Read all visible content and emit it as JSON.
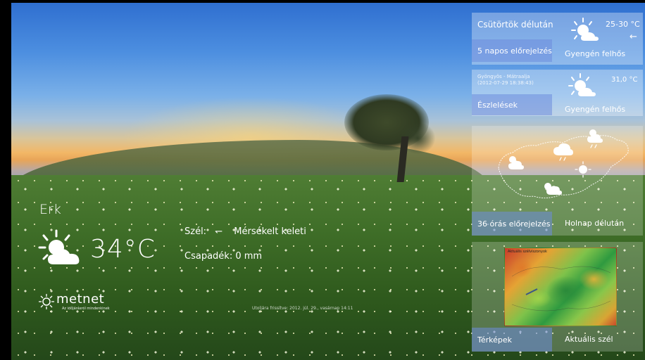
{
  "current": {
    "city": "Erk",
    "temperature": "34°C",
    "wind_label": "Szél:",
    "wind_arrow": "↽",
    "wind_value": "Mérsékelt keleti",
    "precip_label": "Csapadék:",
    "precip_value": "0 mm",
    "icon": "partly-cloudy-sun-icon"
  },
  "logo": {
    "text": "metnet",
    "tagline": "Az időjárásról mindenkinek"
  },
  "updated": "Utoljára frissítve: 2012. júl. 29., vasárnap 14:11",
  "tiles": {
    "forecast": {
      "title": "Csütörtök délután",
      "temp": "25-30 °C",
      "wind_arrow": "←",
      "button": "5 napos előrejelzés",
      "condition": "Gyengén felhős",
      "icon": "sun-cloud-icon"
    },
    "observation": {
      "station": "Gyöngyös - Mátraalja",
      "datetime": "(2012-07-29 18:38:43)",
      "temp": "31,0 °C",
      "button": "Észlelések",
      "condition": "Gyengén felhős",
      "icon": "sun-cloud-icon"
    },
    "forecast36": {
      "button": "36 órás előrejelzés",
      "label": "Holnap délután"
    },
    "maps": {
      "button": "Térképek",
      "label": "Aktuális szél",
      "thumb_title": "Aktuális szélviszonyok"
    }
  },
  "colors": {
    "tile_button": "#6e8cdc",
    "text": "#ffffff"
  }
}
